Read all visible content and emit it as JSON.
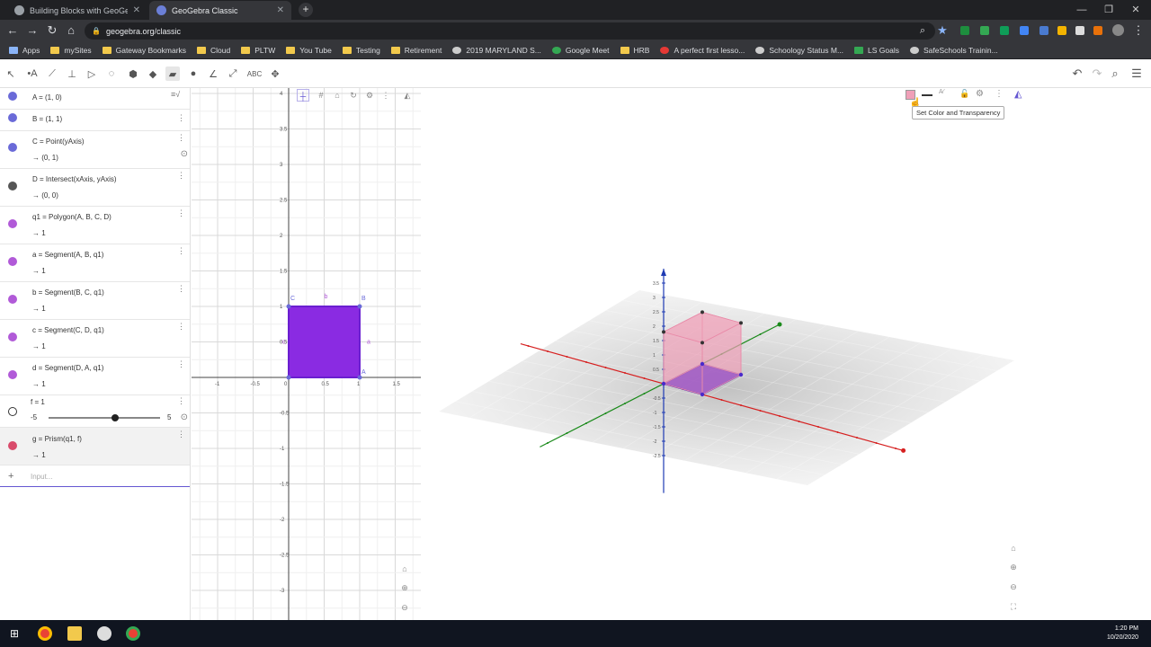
{
  "browser": {
    "tabs": [
      {
        "label": "Building Blocks with GeoGebra",
        "active": false
      },
      {
        "label": "GeoGebra Classic",
        "active": true
      }
    ],
    "url": "geogebra.org/classic",
    "bookmarks": [
      "Apps",
      "mySites",
      "Gateway Bookmarks",
      "Cloud",
      "PLTW",
      "You Tube",
      "Testing",
      "Retirement",
      "2019 MARYLAND S...",
      "Google Meet",
      "HRB",
      "A perfect first lesso...",
      "Schoology Status M...",
      "LS Goals",
      "SafeSchools Trainin..."
    ]
  },
  "algebra": {
    "rows": [
      {
        "def": "A = (1, 0)",
        "val": "",
        "color": "#6a6ad8"
      },
      {
        "def": "B = (1, 1)",
        "val": "",
        "color": "#6a6ad8"
      },
      {
        "def": "C = Point(yAxis)",
        "val": "→  (0, 1)",
        "color": "#6a6ad8"
      },
      {
        "def": "D = Intersect(xAxis, yAxis)",
        "val": "→  (0, 0)",
        "color": "#555555"
      },
      {
        "def": "q1 = Polygon(A, B, C, D)",
        "val": "→  1",
        "color": "#b15ad8"
      },
      {
        "def": "a = Segment(A, B, q1)",
        "val": "→  1",
        "color": "#b15ad8"
      },
      {
        "def": "b = Segment(B, C, q1)",
        "val": "→  1",
        "color": "#b15ad8"
      },
      {
        "def": "c = Segment(C, D, q1)",
        "val": "→  1",
        "color": "#b15ad8"
      },
      {
        "def": "d = Segment(D, A, q1)",
        "val": "→  1",
        "color": "#b15ad8"
      },
      {
        "def": "f = 1",
        "val": "",
        "color": "#ffffff"
      },
      {
        "def": "g = Prism(q1, f)",
        "val": "→  1",
        "color": "#d94b6b"
      }
    ],
    "slider": {
      "min": "-5",
      "max": "5",
      "value": 1
    },
    "input_placeholder": "Input..."
  },
  "graphics2d": {
    "x_ticks": [
      "-1",
      "-0.5",
      "0",
      "0.5",
      "1",
      "1.5"
    ],
    "y_ticks": [
      "4",
      "3.5",
      "3",
      "2.5",
      "2",
      "1.5",
      "1",
      "0.5",
      "-0.5",
      "-1",
      "-1.5",
      "-2",
      "-2.5",
      "-3"
    ],
    "labels": {
      "A": "A",
      "B": "B",
      "C": "C",
      "a": "a",
      "b": "b",
      "c": "c"
    }
  },
  "graphics3d": {
    "tooltip": "Set Color and Transparency",
    "z_ticks": [
      "3.5",
      "3",
      "2.5",
      "2",
      "1.5",
      "1",
      "0.5",
      "-0.5",
      "-1",
      "-1.5",
      "-2",
      "-2.5"
    ]
  },
  "taskbar": {
    "time": "1:20 PM",
    "date": "10/20/2020"
  },
  "colors": {
    "polygon": "#8a2be2",
    "prism": "#f0a0b8",
    "accent": "#6557d2"
  }
}
